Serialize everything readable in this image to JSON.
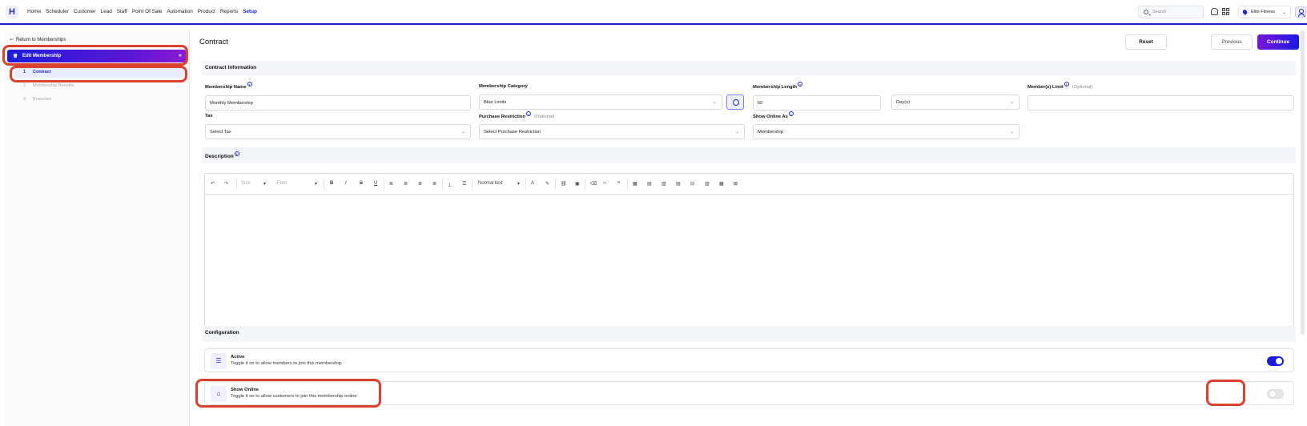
{
  "nav": {
    "logo": "H",
    "items": [
      "Home",
      "Scheduler",
      "Customer",
      "Lead",
      "Staff",
      "Point Of Sale",
      "Automation",
      "Product",
      "Reports",
      "Setup"
    ],
    "active": "Setup",
    "search_placeholder": "Search",
    "location": "Elite Fitness"
  },
  "sidebar": {
    "back_label": "Return to Memberships",
    "edit_label": "Edit Membership",
    "steps": [
      {
        "num": "1",
        "label": "Contract"
      },
      {
        "num": "2",
        "label": "Membership Benefits"
      },
      {
        "num": "3",
        "label": "Branches"
      }
    ]
  },
  "header": {
    "title": "Contract",
    "reset": "Reset",
    "previous": "Previous",
    "continue": "Continue"
  },
  "contract": {
    "section_title": "Contract Information",
    "membership_name": {
      "label": "Membership Name",
      "value": "Monthly Membership"
    },
    "membership_category": {
      "label": "Membership Category",
      "value": "Blue Limits"
    },
    "membership_length": {
      "label": "Membership Length",
      "value": "60",
      "unit": "Day(s)"
    },
    "members_limit": {
      "label": "Member(s) Limit",
      "optional": "(Optional)",
      "value": ""
    },
    "tax": {
      "label": "Tax",
      "value": "Select Tax"
    },
    "purchase_restriction": {
      "label": "Purchase Restriction",
      "optional": "(Optional)",
      "value": "Select Purchase Restriction"
    },
    "show_online_as": {
      "label": "Show Online As",
      "value": "Membership"
    }
  },
  "description": {
    "title": "Description",
    "toolbar": {
      "size": "Size",
      "font": "Font",
      "bold": "B",
      "italic": "I",
      "strike": "S",
      "underline": "U",
      "text_style": "Normal text"
    }
  },
  "configuration": {
    "title": "Configuration",
    "active": {
      "title": "Active",
      "desc": "Toggle it on to allow members to join this membership.",
      "on": true
    },
    "show_online": {
      "title": "Show Online",
      "desc": "Toggle it on to allow customers to join this membership online",
      "on": false
    }
  },
  "colors": {
    "accent": "#1a1ae0",
    "highlight": "#d9432e"
  }
}
